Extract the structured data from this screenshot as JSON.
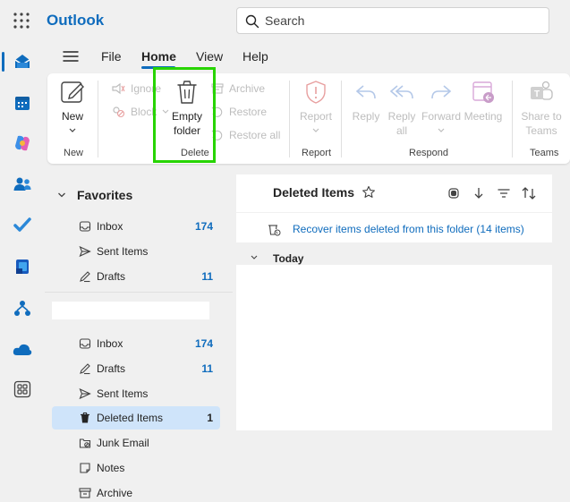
{
  "app": {
    "title": "Outlook"
  },
  "search": {
    "placeholder": "Search"
  },
  "tabs": [
    {
      "label": "File"
    },
    {
      "label": "Home"
    },
    {
      "label": "View"
    },
    {
      "label": "Help"
    }
  ],
  "ribbon": {
    "new": {
      "label": "New",
      "group": "New"
    },
    "ignore": {
      "label": "Ignore"
    },
    "block": {
      "label": "Block"
    },
    "empty_folder": {
      "line1": "Empty",
      "line2": "folder",
      "group": "Delete"
    },
    "archive": {
      "label": "Archive"
    },
    "restore": {
      "label": "Restore"
    },
    "restore_all": {
      "label": "Restore all"
    },
    "report": {
      "label": "Report",
      "group": "Report"
    },
    "reply": {
      "label": "Reply"
    },
    "reply_all": {
      "line1": "Reply",
      "line2": "all"
    },
    "forward": {
      "label": "Forward"
    },
    "meeting": {
      "label": "Meeting"
    },
    "respond_group": "Respond",
    "share_teams": {
      "line1": "Share to",
      "line2": "Teams",
      "group": "Teams"
    }
  },
  "favorites": {
    "title": "Favorites",
    "items": [
      {
        "name": "Inbox",
        "count": "174"
      },
      {
        "name": "Sent Items",
        "count": ""
      },
      {
        "name": "Drafts",
        "count": "11"
      }
    ]
  },
  "folders": [
    {
      "name": "Inbox",
      "count": "174"
    },
    {
      "name": "Drafts",
      "count": "11"
    },
    {
      "name": "Sent Items",
      "count": ""
    },
    {
      "name": "Deleted Items",
      "count": "1"
    },
    {
      "name": "Junk Email",
      "count": ""
    },
    {
      "name": "Notes",
      "count": ""
    },
    {
      "name": "Archive",
      "count": ""
    }
  ],
  "message_list": {
    "title": "Deleted Items",
    "recover_text": "Recover items deleted from this folder (14 items)",
    "group_today": "Today"
  },
  "colors": {
    "accent": "#0f6cbd",
    "highlight": "#27d400",
    "selected": "#cfe4fa"
  }
}
